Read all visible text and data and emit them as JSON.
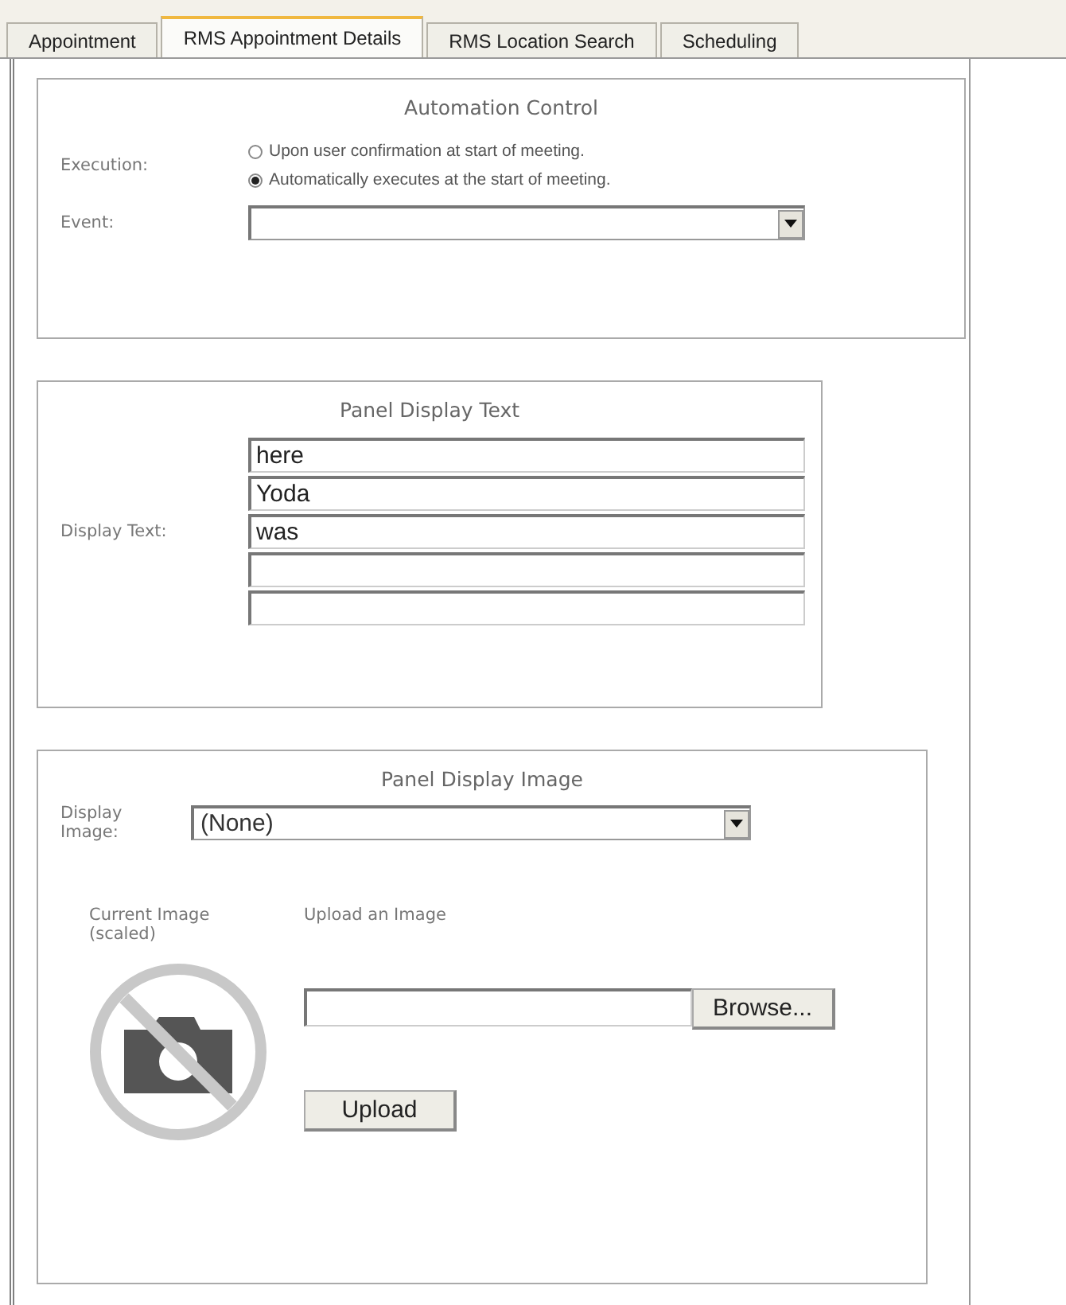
{
  "tabs": [
    {
      "label": "Appointment",
      "selected": false
    },
    {
      "label": "RMS Appointment Details",
      "selected": true
    },
    {
      "label": "RMS Location Search",
      "selected": false
    },
    {
      "label": "Scheduling",
      "selected": false
    }
  ],
  "automation_control": {
    "title": "Automation Control",
    "execution_label": "Execution:",
    "options": [
      {
        "label": "Upon user confirmation at start of meeting.",
        "selected": false
      },
      {
        "label": "Automatically executes at the start of meeting.",
        "selected": true
      }
    ],
    "event_label": "Event:"
  },
  "panel_display_text": {
    "title": "Panel Display Text",
    "label": "Display Text:",
    "fields": [
      {
        "kind": "filled",
        "value": "here"
      },
      {
        "kind": "filled",
        "value": "Yoda"
      },
      {
        "kind": "filled",
        "value": "was"
      },
      {
        "kind": "empty"
      },
      {
        "kind": "empty"
      }
    ]
  },
  "panel_display_image": {
    "title": "Panel Display Image",
    "image_label": "Display Image:",
    "image_value": "(None)",
    "current_image_label": "Current Image (scaled)",
    "upload_label": "Upload an Image",
    "browse_button": "Browse...",
    "upload_button": "Upload"
  }
}
